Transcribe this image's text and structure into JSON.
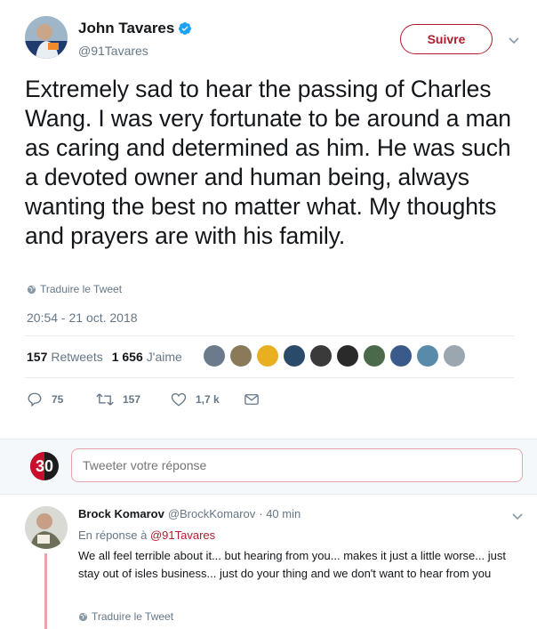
{
  "tweet": {
    "display_name": "John Tavares",
    "handle": "@91Tavares",
    "follow_label": "Suivre",
    "text": "Extremely sad to hear the passing of Charles Wang. I was very fortunate to be around a man as caring and determined as him. He was such a devoted owner and human being, always wanting the best no matter what. My thoughts and prayers are with his family.",
    "translate_label": "Traduire le Tweet",
    "timestamp": "20:54 - 21 oct. 2018",
    "retweets_count": "157",
    "retweets_label": "Retweets",
    "likes_count": "1 656",
    "likes_label": "J'aime",
    "actions": {
      "replies": "75",
      "retweets": "157",
      "likes": "1,7 k"
    },
    "liker_colors": [
      "#6b7b8c",
      "#8a7a5a",
      "#e8b020",
      "#2a4a6a",
      "#3a3a3a",
      "#2a2a2a",
      "#4a6a4a",
      "#3a5a8a",
      "#5a8aaa",
      "#9aa6b0"
    ]
  },
  "reply_box": {
    "avatar_text": "30",
    "placeholder": "Tweeter votre réponse"
  },
  "reply": {
    "display_name": "Brock Komarov",
    "handle": "@BrockKomarov",
    "time": "· 40 min",
    "replying_prefix": "En réponse à",
    "replying_to": "@91Tavares",
    "text": "We all feel terrible about it... but hearing from you... makes it just a little worse... just stay out of isles business... just do your thing and we don't want to hear from you",
    "translate_label": "Traduire le Tweet"
  },
  "colors": {
    "accent": "#b01c2e",
    "secondary_text": "#657786",
    "verified": "#1da1f2"
  }
}
